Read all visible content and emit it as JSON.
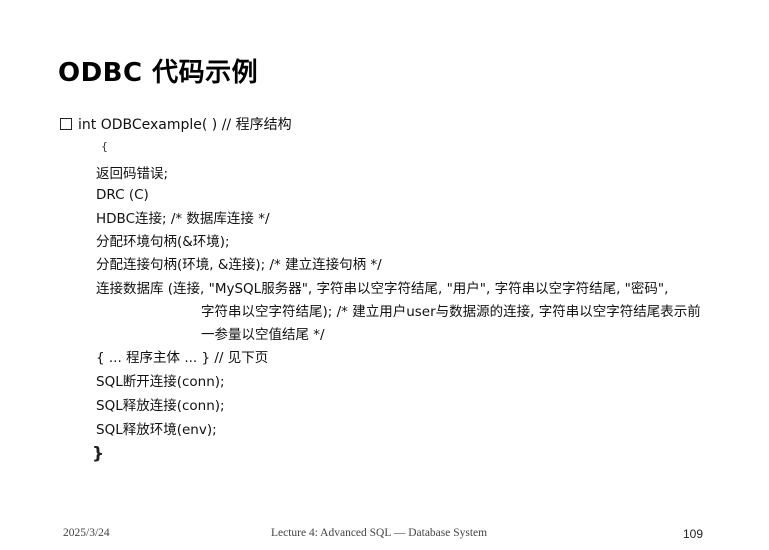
{
  "slide": {
    "title": "ODBC 代码示例",
    "header_line": "int ODBCexample( ) // 程序结构",
    "open_brace": "{",
    "lines": [
      "返回码错误;",
      "DRC (C)",
      "HDBC连接; /* 数据库连接 */",
      "分配环境句柄(&环境);",
      "分配连接句柄(环境, &连接); /* 建立连接句柄 */",
      "连接数据库 (连接, \"MySQL服务器\", 字符串以空字符结尾, \"用户\", 字符串以空字符结尾, \"密码\",",
      "字符串以空字符结尾); /* 建立用户user与数据源的连接, 字符串以空字符结尾表示前",
      "一参量以空值结尾 */",
      "{ ... 程序主体 ... } // 见下页",
      "SQL断开连接(conn);",
      "SQL释放连接(conn);",
      "SQL释放环境(env);"
    ],
    "close_brace": "}"
  },
  "footer": {
    "date": "2025/3/24",
    "center": "Lecture 4: Advanced SQL — Database System",
    "page": "109"
  }
}
